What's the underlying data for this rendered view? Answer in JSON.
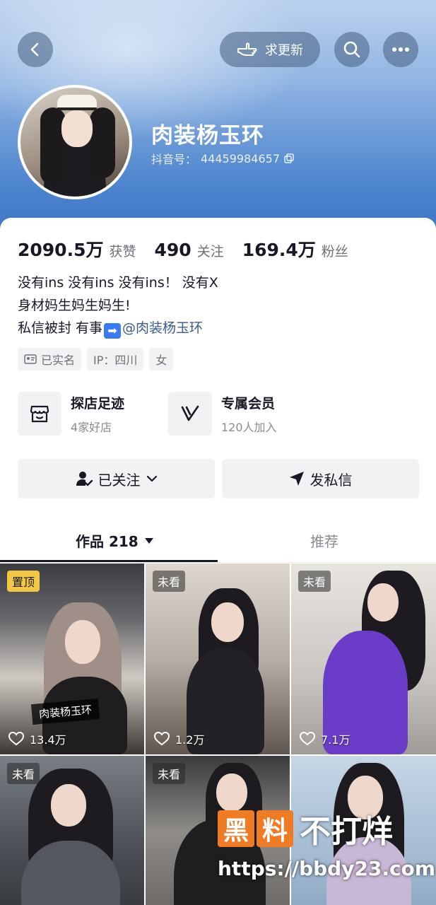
{
  "header": {
    "request_update_label": "求更新",
    "profile_name": "肉装杨玉环",
    "douyin_id_label": "抖音号：",
    "douyin_id": "44459984657"
  },
  "stats": [
    {
      "number": "2090.5万",
      "label": "获赞"
    },
    {
      "number": "490",
      "label": "关注"
    },
    {
      "number": "169.4万",
      "label": "粉丝"
    }
  ],
  "bio": {
    "line1": "没有ins 没有ins 没有ins！ 没有X",
    "line2": "身材妈生妈生妈生!",
    "line3_prefix": "私信被封 有事",
    "line3_emoji": "➡",
    "line3_mention": "@肉装杨玉环"
  },
  "tags": {
    "verified": "已实名",
    "ip": "IP：四川",
    "gender": "女"
  },
  "features": [
    {
      "title": "探店足迹",
      "subtitle": "4家好店",
      "icon": "shop-icon"
    },
    {
      "title": "专属会员",
      "subtitle": "120人加入",
      "icon": "member-v-icon"
    }
  ],
  "actions": {
    "followed_label": "已关注",
    "message_label": "发私信"
  },
  "tabs": {
    "works_label": "作品 218",
    "recommend_label": "推荐"
  },
  "videos": [
    {
      "badge": "置顶",
      "likes": "13.4万",
      "watermark": "肉装杨玉环"
    },
    {
      "badge": "未看",
      "likes": "1.2万"
    },
    {
      "badge": "未看",
      "likes": "7.1万"
    },
    {
      "badge": "未看"
    },
    {
      "badge": "未看"
    },
    {}
  ],
  "watermark": {
    "logo_chars": [
      "黑",
      "料"
    ],
    "text": "不打烊",
    "url": "https://bbdy23.com"
  },
  "colors": {
    "accent_link": "#3a5b8f",
    "pin_badge": "#f3c646",
    "watermark_orange": "#ef7b25"
  }
}
